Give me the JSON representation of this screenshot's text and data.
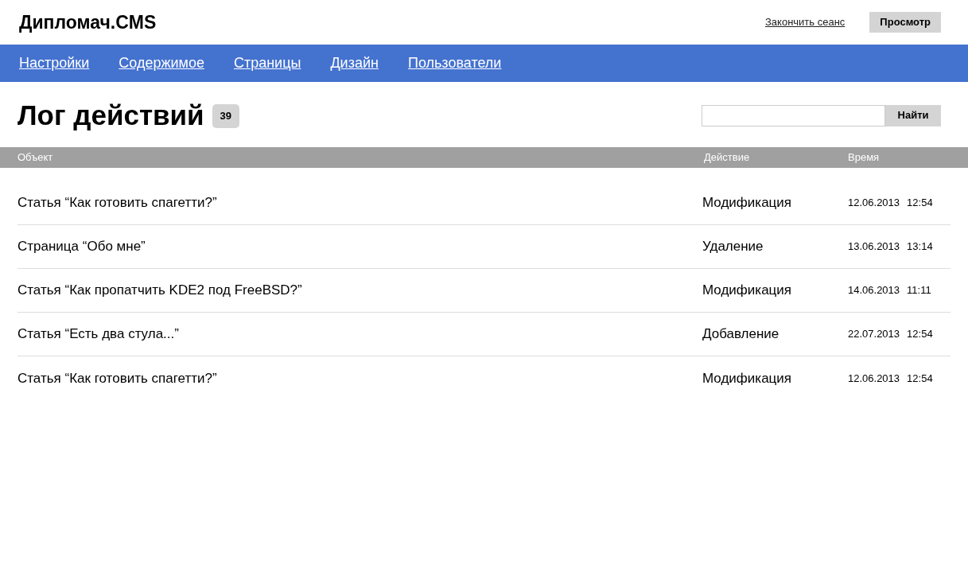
{
  "brand": "Дипломач.CMS",
  "header_actions": {
    "logout": "Закончить сеанс",
    "preview": "Просмотр"
  },
  "nav": [
    {
      "label": "Настройки"
    },
    {
      "label": "Содержимое"
    },
    {
      "label": "Страницы"
    },
    {
      "label": "Дизайн"
    },
    {
      "label": "Пользователи"
    }
  ],
  "page": {
    "title": "Лог действий",
    "count": "39"
  },
  "search": {
    "button": "Найти"
  },
  "table": {
    "columns": [
      "Объект",
      "Действие",
      "Время"
    ],
    "rows": [
      {
        "object": "Статья “Как готовить спагетти?”",
        "action": "Модификация",
        "date": "12.06.2013",
        "time": "12:54"
      },
      {
        "object": "Страница “Обо мне”",
        "action": "Удаление",
        "date": "13.06.2013",
        "time": "13:14"
      },
      {
        "object": "Статья “Как пропатчить KDE2 под FreeBSD?”",
        "action": "Модификация",
        "date": "14.06.2013",
        "time": "11:11"
      },
      {
        "object": "Статья “Есть два стула...”",
        "action": "Добавление",
        "date": "22.07.2013",
        "time": "12:54"
      },
      {
        "object": "Статья “Как готовить спагетти?”",
        "action": "Модификация",
        "date": "12.06.2013",
        "time": "12:54"
      }
    ]
  }
}
